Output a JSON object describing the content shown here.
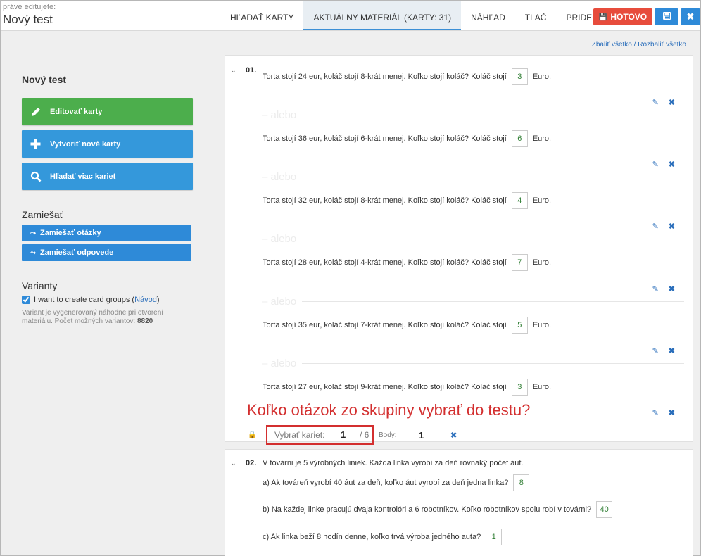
{
  "header": {
    "editing_label": "práve editujete:",
    "doc_title": "Nový test",
    "tabs": [
      {
        "label": "HĽADAŤ KARTY"
      },
      {
        "label": "AKTUÁLNY MATERIÁL (KARTY: 31)"
      },
      {
        "label": "NÁHĽAD"
      },
      {
        "label": "TLAČ"
      },
      {
        "label": "PRIDELIŤ"
      }
    ],
    "done_label": "HOTOVO",
    "save_icon": "save-icon",
    "close_icon": "close-icon"
  },
  "collapse": {
    "collapse_all": "Zbaliť všetko",
    "separator": " / ",
    "expand_all": "Rozbaliť všetko"
  },
  "sidebar": {
    "title": "Nový test",
    "buttons": [
      {
        "label": "Editovať karty",
        "icon": "pencil-icon",
        "color": "#4cae4c"
      },
      {
        "label": "Vytvoriť nové karty",
        "icon": "plus-icon",
        "color": "#3498db"
      },
      {
        "label": "Hľadať viac kariet",
        "icon": "search-icon",
        "color": "#3498db"
      }
    ],
    "shuffle_title": "Zamiešať",
    "shuffle_questions": "Zamiešať otázky",
    "shuffle_answers": "Zamiešať odpovede",
    "variants_title": "Varianty",
    "groups_checkbox_label": "I want to create card groups (",
    "groups_link": "Návod",
    "groups_close": ")",
    "help_text": "Variant je vygenerovaný náhodne pri otvorení materiálu. Počet možných variantov: ",
    "variant_count": "8820"
  },
  "card1": {
    "number": "01.",
    "alebo": "alebo",
    "variants": [
      {
        "pre": "Torta stojí 24 eur, koláč stojí 8-krát menej. Koľko stojí koláč? Koláč stojí",
        "answer": "3",
        "post": "Euro."
      },
      {
        "pre": "Torta stojí 36 eur, koláč stojí 6-krát menej. Koľko stojí koláč? Koláč stojí",
        "answer": "6",
        "post": "Euro."
      },
      {
        "pre": "Torta stojí 32 eur, koláč stojí 8-krát menej. Koľko stojí koláč? Koláč stojí",
        "answer": "4",
        "post": "Euro."
      },
      {
        "pre": "Torta stojí 28 eur, koláč stojí 4-krát menej. Koľko stojí koláč? Koláč stojí",
        "answer": "7",
        "post": "Euro."
      },
      {
        "pre": "Torta stojí 35 eur, koláč stojí 7-krát menej. Koľko stojí koláč? Koláč stojí",
        "answer": "5",
        "post": "Euro."
      },
      {
        "pre": "Torta stojí 27 eur, koláč stojí 9-krát menej. Koľko stojí koláč? Koláč stojí",
        "answer": "3",
        "post": "Euro."
      }
    ],
    "footer": {
      "pick_label": "Vybrať kariet:",
      "pick_value": "1",
      "pick_total": "/ 6",
      "body_label": "Body:",
      "body_value": "1"
    }
  },
  "annotation": "Koľko otázok zo skupiny vybrať do testu?",
  "card2": {
    "number": "02.",
    "intro": "V továrni je 5 výrobných liniek. Každá linka vyrobí za deň rovnaký počet áut.",
    "items": [
      {
        "text": "a) Ak továreň vyrobí 40 áut za deň, koľko áut vyrobí za deň jedna linka?",
        "answer": "8"
      },
      {
        "text": "b) Na každej linke pracujú dvaja kontrolóri a 6 robotníkov. Koľko robotníkov spolu robí v továrni?",
        "answer": "40"
      },
      {
        "text": "c) Ak linka beží 8 hodín denne, koľko trvá výroba jedného auta?",
        "answer": "1"
      }
    ]
  }
}
